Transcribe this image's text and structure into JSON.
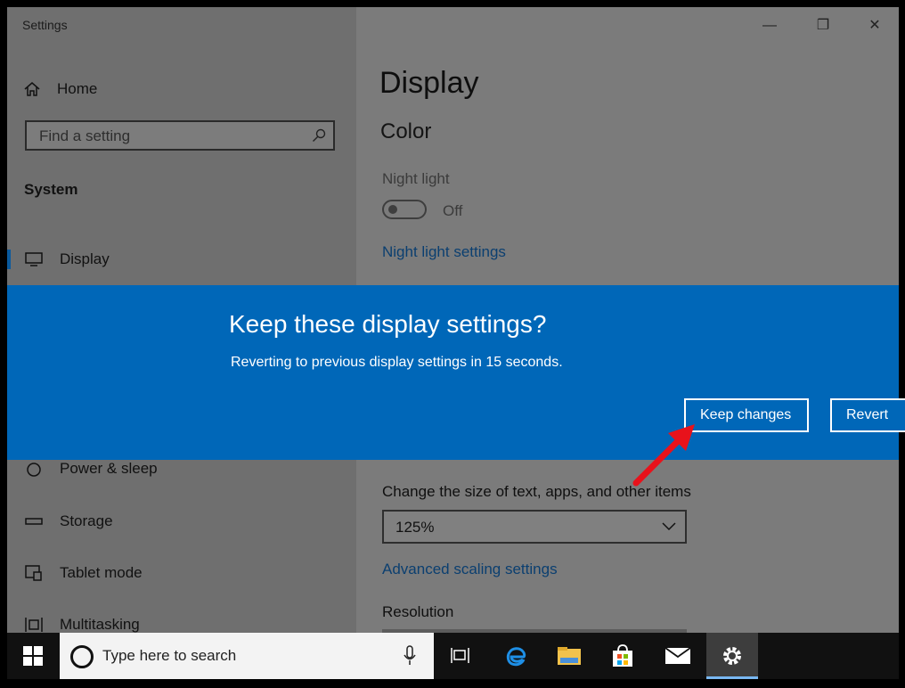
{
  "window": {
    "title": "Settings",
    "controls": {
      "minimize": "—",
      "maximize": "❐",
      "close": "✕"
    }
  },
  "sidebar": {
    "home_label": "Home",
    "search_placeholder": "Find a setting",
    "section_label": "System",
    "items": [
      {
        "label": "Display",
        "icon": "monitor-icon",
        "active": true
      },
      {
        "label": "Power & sleep",
        "icon": "power-icon",
        "active": false
      },
      {
        "label": "Storage",
        "icon": "storage-icon",
        "active": false
      },
      {
        "label": "Tablet mode",
        "icon": "tablet-icon",
        "active": false
      },
      {
        "label": "Multitasking",
        "icon": "multitasking-icon",
        "active": false
      }
    ]
  },
  "content": {
    "title": "Display",
    "color_heading": "Color",
    "night_light_label": "Night light",
    "night_light_state": "Off",
    "night_light_settings_link": "Night light settings",
    "scale_label": "Change the size of text, apps, and other items",
    "scale_value": "125%",
    "advanced_scaling_link": "Advanced scaling settings",
    "resolution_label": "Resolution"
  },
  "dialog": {
    "title": "Keep these display settings?",
    "message": "Reverting to previous display settings in 15 seconds.",
    "keep_button": "Keep changes",
    "revert_button": "Revert"
  },
  "taskbar": {
    "search_placeholder": "Type here to search",
    "icons": [
      "windows-start-icon",
      "task-view-icon",
      "edge-icon",
      "file-explorer-icon",
      "store-icon",
      "mail-icon",
      "settings-gear-icon"
    ]
  },
  "colors": {
    "dialog_bg": "#0067b8",
    "link": "#0b3f70",
    "annotation_arrow": "#e8121b"
  }
}
